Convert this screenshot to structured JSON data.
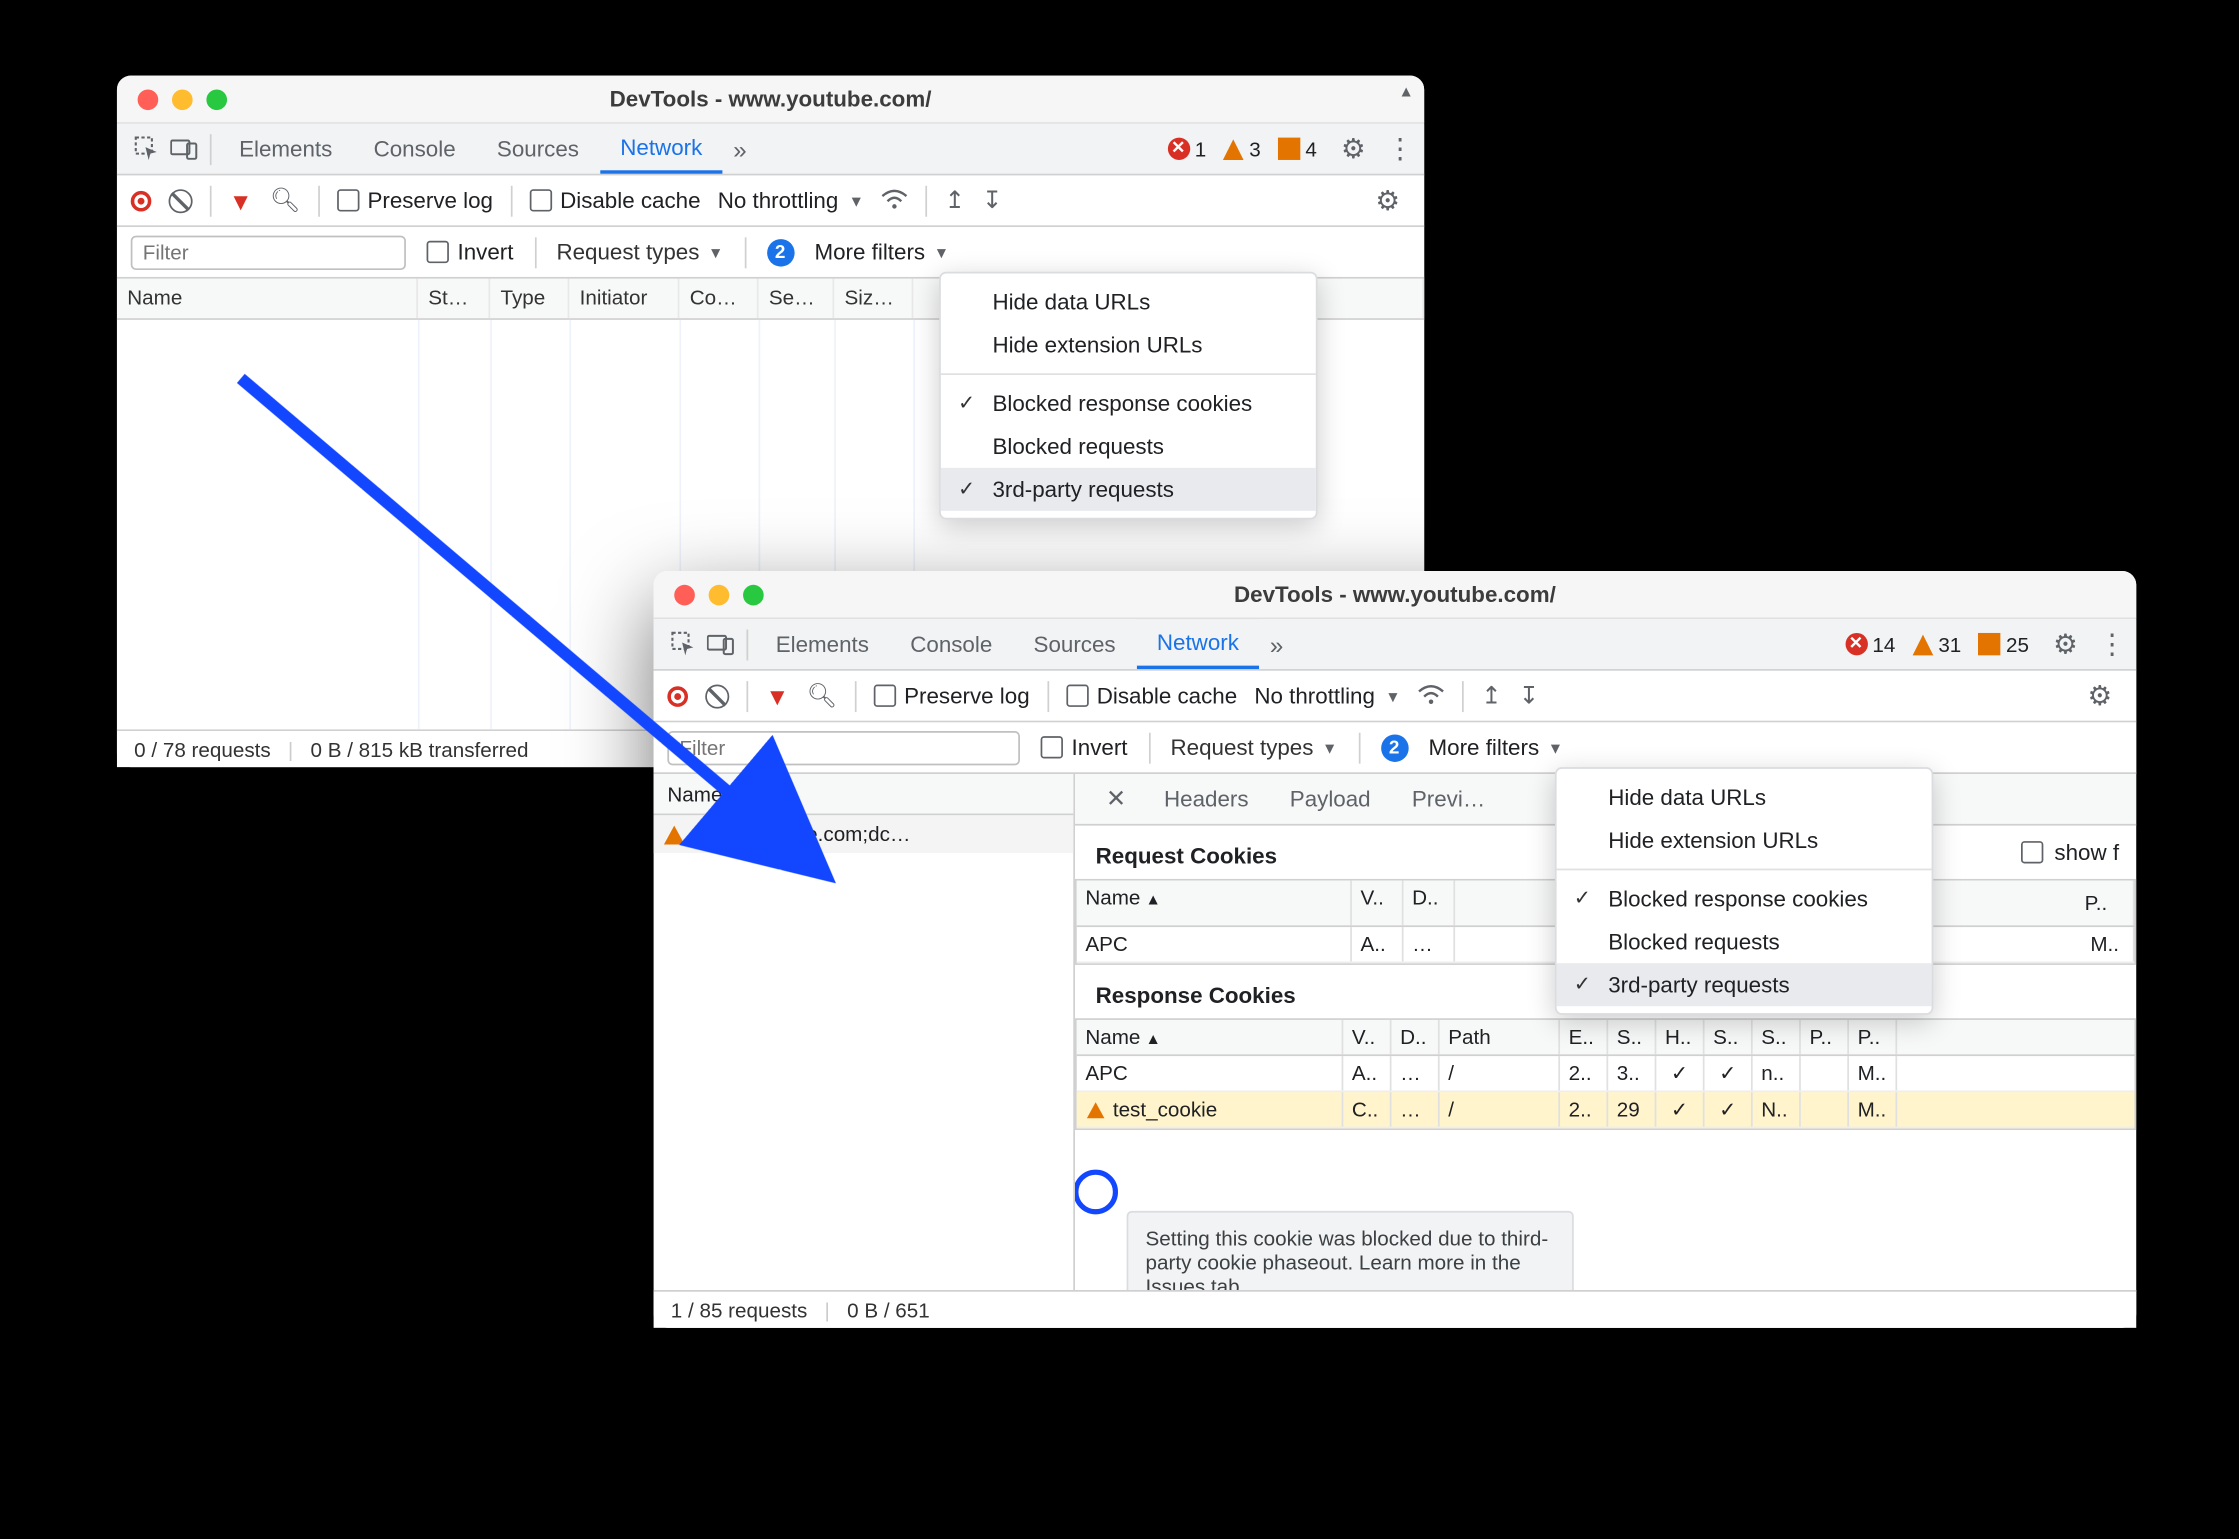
{
  "window1": {
    "title": "DevTools - www.youtube.com/",
    "tabs": [
      "Elements",
      "Console",
      "Sources",
      "Network"
    ],
    "active_tab": "Network",
    "overflow": "»",
    "errors": 1,
    "warnings": 3,
    "info": 4,
    "toolbar": {
      "preserve": "Preserve log",
      "disable_cache": "Disable cache",
      "throttling": "No throttling"
    },
    "filter": {
      "placeholder": "Filter",
      "invert": "Invert",
      "request_types": "Request types",
      "badge": "2",
      "more_filters": "More filters"
    },
    "dropdown": {
      "items": [
        {
          "label": "Hide data URLs",
          "checked": false
        },
        {
          "label": "Hide extension URLs",
          "checked": false
        },
        {
          "sep": true
        },
        {
          "label": "Blocked response cookies",
          "checked": true
        },
        {
          "label": "Blocked requests",
          "checked": false
        },
        {
          "label": "3rd-party requests",
          "checked": true,
          "hover": true
        }
      ]
    },
    "headers": [
      "Name",
      "St…",
      "Type",
      "Initiator",
      "Co…",
      "Se…",
      "Siz…",
      ""
    ],
    "status": {
      "requests": "0 / 78 requests",
      "transfer": "0 B / 815 kB transferred"
    }
  },
  "window2": {
    "title": "DevTools - www.youtube.com/",
    "tabs": [
      "Elements",
      "Console",
      "Sources",
      "Network"
    ],
    "active_tab": "Network",
    "overflow": "»",
    "errors": 14,
    "warnings": 31,
    "info": 25,
    "toolbar": {
      "preserve": "Preserve log",
      "disable_cache": "Disable cache",
      "throttling": "No throttling"
    },
    "filter": {
      "placeholder": "Filter",
      "invert": "Invert",
      "request_types": "Request types",
      "badge": "2",
      "more_filters": "More filters"
    },
    "dropdown": {
      "items": [
        {
          "label": "Hide data URLs",
          "checked": false
        },
        {
          "label": "Hide extension URLs",
          "checked": false
        },
        {
          "sep": true
        },
        {
          "label": "Blocked response cookies",
          "checked": true
        },
        {
          "label": "Blocked requests",
          "checked": false
        },
        {
          "label": "3rd-party requests",
          "checked": true,
          "hover": true
        }
      ]
    },
    "list": {
      "header": "Name",
      "item": "www.youtube.com;dc…"
    },
    "detail_tabs": [
      "Headers",
      "Payload",
      "Previ…"
    ],
    "request_cookies": {
      "title": "Request Cookies",
      "show_filtered": "show f",
      "headers": [
        "Name",
        "V..",
        "D..",
        "",
        "P.."
      ],
      "rows": [
        [
          "APC",
          "A..",
          "…",
          "",
          "M.."
        ]
      ]
    },
    "response_cookies": {
      "title": "Response Cookies",
      "headers": [
        "Name",
        "V..",
        "D..",
        "Path",
        "E..",
        "S..",
        "H..",
        "S..",
        "S..",
        "P..",
        "P.."
      ],
      "rows": [
        [
          "APC",
          "A..",
          "…",
          "/",
          "2..",
          "3..",
          "✓",
          "✓",
          "n..",
          "",
          "M.."
        ],
        [
          "test_cookie",
          "C..",
          "…",
          "/",
          "2..",
          "29",
          "✓",
          "✓",
          "N..",
          "",
          "M.."
        ]
      ],
      "highlighted_row": 1
    },
    "tooltip": "Setting this cookie was blocked due to third-party cookie phaseout. Learn more in the Issues tab.",
    "status": {
      "requests": "1 / 85 requests",
      "transfer": "0 B / 651"
    }
  }
}
